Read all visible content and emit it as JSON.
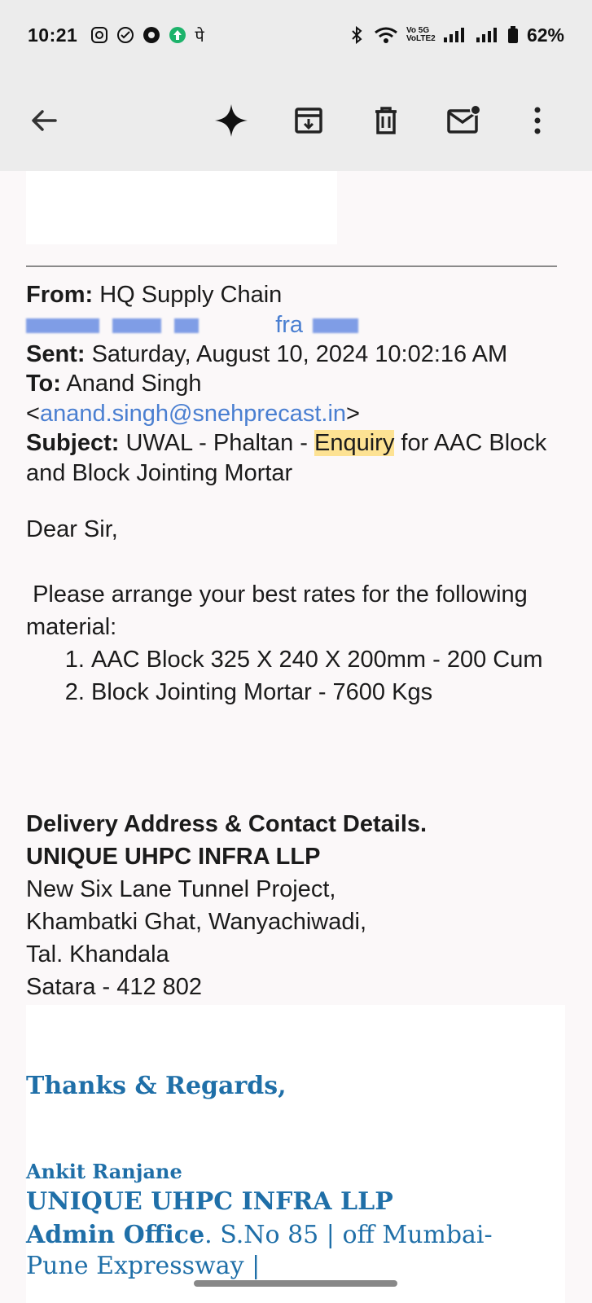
{
  "status_bar": {
    "time": "10:21",
    "battery": "62%",
    "network_label": "Vo 5G VoLTE2"
  },
  "app_bar": {
    "icons": [
      "back-arrow-icon",
      "sparkle-icon",
      "archive-icon",
      "delete-icon",
      "mark-unread-icon",
      "more-vert-icon"
    ]
  },
  "email": {
    "from_label": "From:",
    "from_value": "HQ Supply Chain",
    "from_email_visible": "fra",
    "sent_label": "Sent:",
    "sent_value": "Saturday, August 10, 2024 10:02:16 AM",
    "to_label": "To:",
    "to_name": "Anand Singh",
    "to_email_open": "<",
    "to_email": "anand.singh@snehprecast.in",
    "to_email_close": ">",
    "subject_label": "Subject:",
    "subject_pre": "UWAL - Phaltan -",
    "subject_highlight": "Enquiry",
    "subject_post": "for AAC Block and Block Jointing Mortar",
    "greeting": "Dear Sir,",
    "intro": " Please arrange your best rates for the following material:",
    "items": [
      "AAC Block 325 X 240 X 200mm - 200 Cum",
      "Block Jointing Mortar - 7600 Kgs"
    ],
    "delivery_heading": "Delivery Address & Contact Details.",
    "company": "UNIQUE UHPC INFRA LLP",
    "address_lines": [
      "New Six Lane Tunnel Project,",
      "Khambatki Ghat, Wanyachiwadi,",
      "Tal. Khandala",
      "Satara - 412 802"
    ]
  },
  "signature": {
    "thanks": "Thanks & Regards,",
    "name": "Ankit Ranjane",
    "company": "UNIQUE UHPC INFRA LLP",
    "office_label": "Admin Office",
    "office_rest": ". S.No 85 | off Mumbai-Pune Expressway |"
  },
  "colors": {
    "link": "#4a7fd1",
    "highlight": "#fde293",
    "signature": "#1f6fa8"
  }
}
